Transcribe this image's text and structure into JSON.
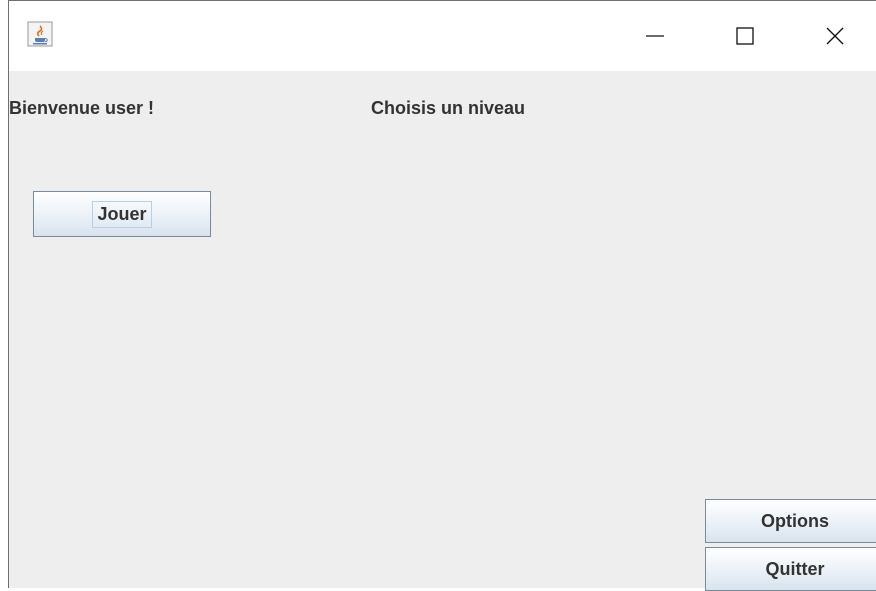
{
  "window": {
    "app_icon": "java-cup-icon",
    "controls": {
      "minimize_icon": "minimize-icon",
      "maximize_icon": "maximize-icon",
      "close_icon": "close-icon"
    }
  },
  "content": {
    "welcome_label": "Bienvenue user !",
    "level_label": "Choisis un niveau",
    "play_button": "Jouer",
    "options_button": "Options",
    "quit_button": "Quitter"
  },
  "colors": {
    "background": "#eeeeee",
    "titlebar": "#ffffff",
    "text": "#333333",
    "button_border": "#7a8a99"
  }
}
